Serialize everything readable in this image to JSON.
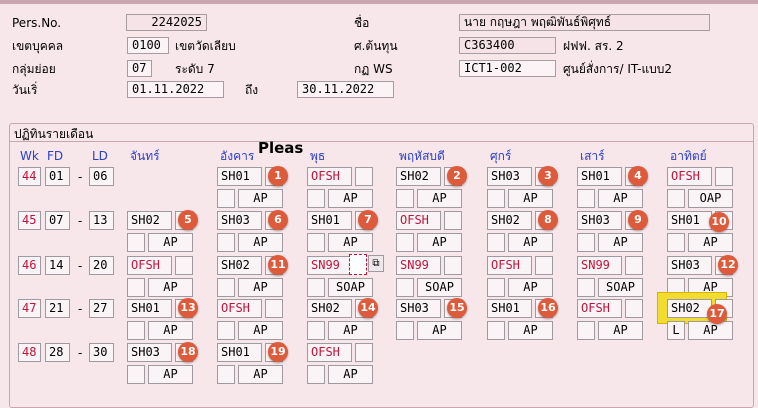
{
  "header": {
    "pers_no_label": "Pers.No.",
    "pers_no_value": "2242025",
    "name_label": "ชื่อ",
    "name_value": "นาย กฤษฎา พฤฒิพันธ์พิศุทธ์",
    "area_label": "เขตบุคคล",
    "area_value": "0100",
    "area_text": "เขตวัดเลียบ",
    "cost_center_label": "ศ.ต้นทุน",
    "cost_center_value": "C363400",
    "dept_text": "ฝฟฟ. สร. 2",
    "subgroup_label": "กลุ่มย่อย",
    "subgroup_value": "07",
    "level_text": "ระดับ 7",
    "ws_rule_label": "กฏ WS",
    "ws_rule_value": "ICT1-002",
    "ws_rule_text": "ศูนย์สั่งการ/ IT-แบบ2",
    "date_from_label": "วันเริ่",
    "date_from_value": "01.11.2022",
    "date_to_label": "ถึง",
    "date_to_value": "30.11.2022"
  },
  "calendar": {
    "title": "ปฏิทินรายเดือน",
    "overlay_text": "Pleas",
    "columns": {
      "wk": "Wk",
      "fd": "FD",
      "ld": "LD",
      "mon": "จันทร์",
      "tue": "อังคาร",
      "wed": "พุธ",
      "thu": "พฤหัสบดี",
      "fri": "ศุกร์",
      "sat": "เสาร์",
      "sun": "อาทิตย์"
    },
    "dash": "-",
    "weeks": [
      {
        "wk": "44",
        "fd": "01",
        "ld": "06",
        "days": [
          null,
          {
            "code": "SH01",
            "sub": "AP",
            "badge": "1"
          },
          {
            "code": "OFSH",
            "sub": "AP"
          },
          {
            "code": "SH02",
            "sub": "AP",
            "badge": "2"
          },
          {
            "code": "SH03",
            "sub": "AP",
            "badge": "3"
          },
          {
            "code": "SH01",
            "sub": "AP",
            "badge": "4"
          },
          {
            "code": "OFSH",
            "sub": "OAP"
          }
        ]
      },
      {
        "wk": "45",
        "fd": "07",
        "ld": "13",
        "days": [
          {
            "code": "SH02",
            "sub": "AP",
            "badge": "5"
          },
          {
            "code": "SH03",
            "sub": "AP",
            "badge": "6"
          },
          {
            "code": "SH01",
            "sub": "AP",
            "badge": "7"
          },
          {
            "code": "OFSH",
            "sub": "AP"
          },
          {
            "code": "SH02",
            "sub": "AP",
            "badge": "8"
          },
          {
            "code": "SH03",
            "sub": "AP",
            "badge": "9"
          },
          {
            "code": "SH01",
            "sub": "AP",
            "badge": "10"
          }
        ]
      },
      {
        "wk": "46",
        "fd": "14",
        "ld": "20",
        "days": [
          {
            "code": "OFSH",
            "sub": "AP"
          },
          {
            "code": "SH02",
            "sub": "AP",
            "badge": "11"
          },
          {
            "code": "SN99",
            "sub": "SOAP"
          },
          {
            "code": "SN99",
            "sub": "SOAP"
          },
          {
            "code": "OFSH",
            "sub": "AP"
          },
          {
            "code": "SN99",
            "sub": "SOAP"
          },
          {
            "code": "SH03",
            "sub": "AP",
            "badge": "12"
          }
        ]
      },
      {
        "wk": "47",
        "fd": "21",
        "ld": "27",
        "days": [
          {
            "code": "SH01",
            "sub": "AP",
            "badge": "13"
          },
          {
            "code": "OFSH",
            "sub": "AP"
          },
          {
            "code": "SH02",
            "sub": "AP",
            "badge": "14"
          },
          {
            "code": "SH03",
            "sub": "AP",
            "badge": "15"
          },
          {
            "code": "SH01",
            "sub": "AP",
            "badge": "16"
          },
          {
            "code": "OFSH",
            "sub": "AP"
          },
          {
            "code": "SH02",
            "sub": "AP",
            "badge": "17",
            "small": "L"
          }
        ]
      },
      {
        "wk": "48",
        "fd": "28",
        "ld": "30",
        "days": [
          {
            "code": "SH03",
            "sub": "AP",
            "badge": "18"
          },
          {
            "code": "SH01",
            "sub": "AP",
            "badge": "19"
          },
          {
            "code": "OFSH",
            "sub": "AP"
          },
          null,
          null,
          null,
          null
        ]
      }
    ]
  },
  "colors": {
    "background": "#f7e6ea",
    "header_blue": "#2b3fc7",
    "off_red": "#c2143a",
    "badge": "#dd5a3a",
    "highlight": "#f2dc30"
  }
}
